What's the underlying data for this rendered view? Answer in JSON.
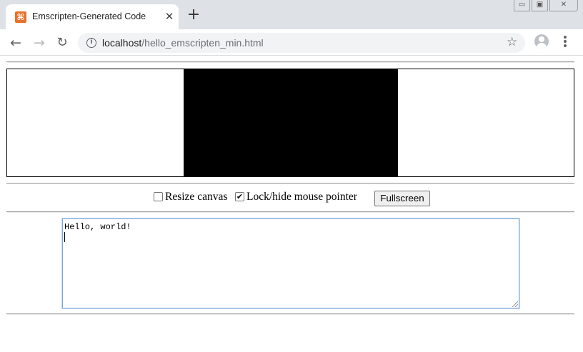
{
  "browser": {
    "tab": {
      "title": "Emscripten-Generated Code",
      "favicon": "emscripten-icon",
      "close_glyph": "✕"
    },
    "new_tab_glyph": "+",
    "window_controls": {
      "minimize": "▭",
      "maximize": "▣",
      "close": "✕"
    },
    "nav": {
      "back": "←",
      "forward": "→",
      "reload": "↻"
    },
    "address_bar": {
      "host": "localhost",
      "path": "/hello_emscripten_min.html",
      "info_glyph": "i",
      "bookmark_glyph": "☆"
    }
  },
  "page": {
    "canvas": {
      "background": "#000000"
    },
    "controls": {
      "resize_canvas": {
        "label": "Resize canvas",
        "checked": false
      },
      "lock_pointer": {
        "label": "Lock/hide mouse pointer",
        "checked": true,
        "check_glyph": "✔"
      },
      "fullscreen_button": "Fullscreen"
    },
    "output": {
      "text": "Hello, world!"
    }
  },
  "colors": {
    "tabstrip": "#dee1e6",
    "favicon": "#e8702a",
    "textarea_focus_border": "#7fa6d9"
  }
}
